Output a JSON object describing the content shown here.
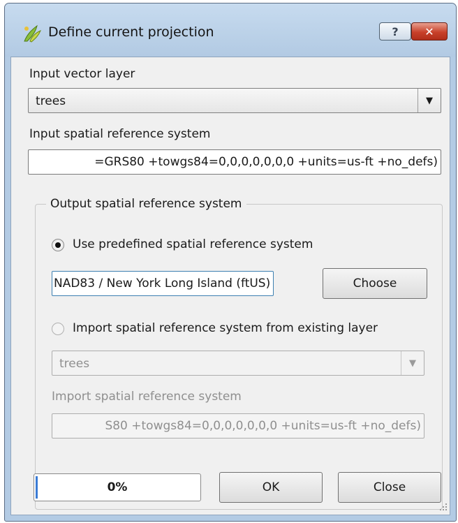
{
  "window": {
    "title": "Define current projection",
    "help_label": "?",
    "close_label": "✕"
  },
  "input_layer": {
    "label": "Input vector layer",
    "value": "trees"
  },
  "input_srs": {
    "label": "Input spatial reference system",
    "value": "=GRS80 +towgs84=0,0,0,0,0,0,0 +units=us-ft +no_defs)"
  },
  "output_group": {
    "title": "Output spatial reference system",
    "predefined": {
      "label": "Use predefined spatial reference system",
      "selected": true,
      "value": "NAD83 / New York Long Island (ftUS)",
      "choose_label": "Choose"
    },
    "import": {
      "label": "Import spatial reference system from existing layer",
      "selected": false,
      "layer_value": "trees",
      "srs_label": "Import spatial reference system",
      "srs_value": "S80 +towgs84=0,0,0,0,0,0,0 +units=us-ft +no_defs)"
    }
  },
  "footer": {
    "progress_text": "0%",
    "progress_value": 0,
    "ok_label": "OK",
    "close_label": "Close"
  },
  "colors": {
    "frame": "#b3cbe4",
    "client": "#f0f0f0",
    "close_button": "#c8412a",
    "progress_bar": "#3a7bd5"
  }
}
